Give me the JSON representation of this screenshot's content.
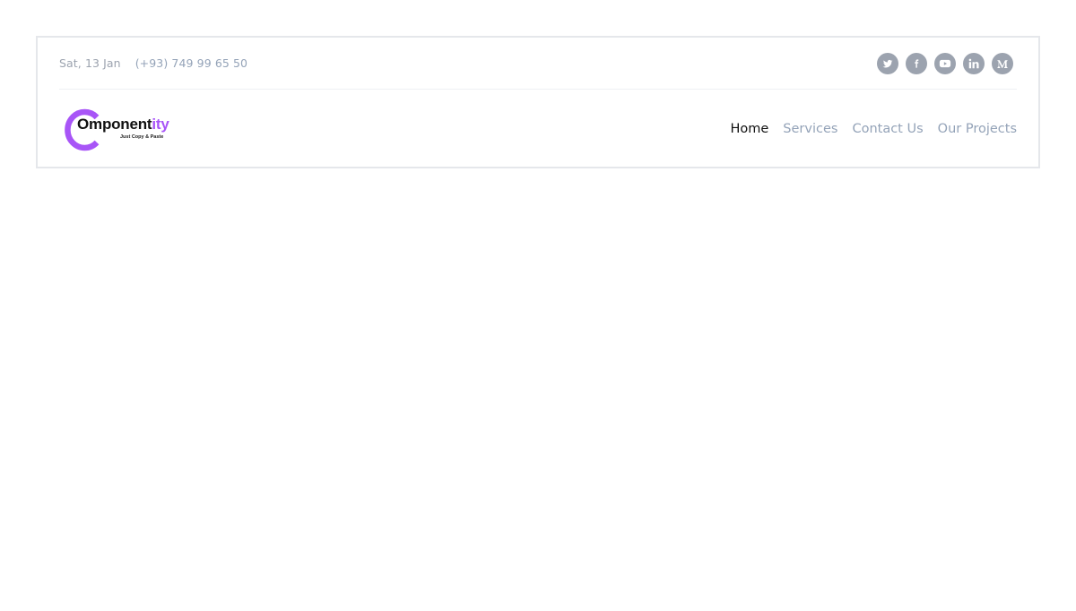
{
  "topbar": {
    "date": "Sat, 13 Jan",
    "phone": "(+93) 749 99 65 50",
    "socials": [
      {
        "icon": "twitter-icon"
      },
      {
        "icon": "facebook-icon"
      },
      {
        "icon": "youtube-icon"
      },
      {
        "icon": "linkedin-icon"
      },
      {
        "icon": "medium-icon"
      }
    ]
  },
  "logo": {
    "text_main": "Omponent",
    "text_accent": "ity",
    "tagline": "Just Copy & Paste",
    "accent_color": "#a855f7"
  },
  "nav": {
    "items": [
      {
        "label": "Home",
        "active": true
      },
      {
        "label": "Services",
        "active": false
      },
      {
        "label": "Contact Us",
        "active": false
      },
      {
        "label": "Our Projects",
        "active": false
      }
    ]
  },
  "colors": {
    "muted": "#94a3b8",
    "text": "#111111",
    "border": "#e5e7eb"
  }
}
